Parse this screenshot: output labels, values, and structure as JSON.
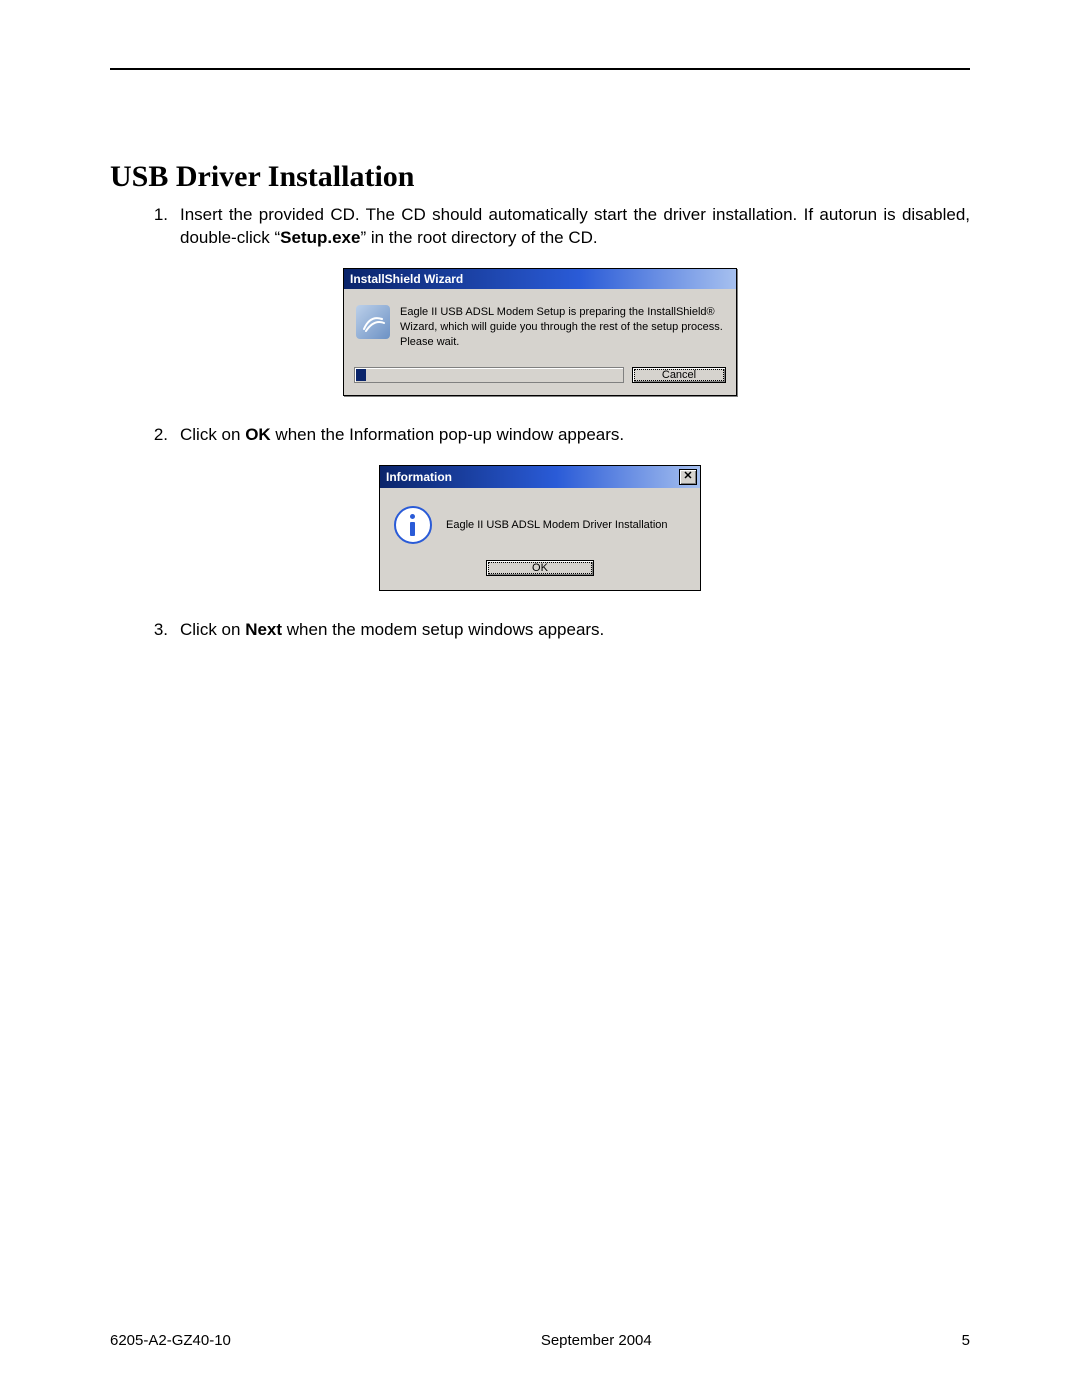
{
  "heading": "USB Driver Installation",
  "steps": {
    "s1": {
      "num": "1.",
      "pre": "Insert the provided CD. The CD should automatically start the driver installation. If autorun is disabled, double-click “",
      "setup": "Setup.exe",
      "post": "” in the root directory of the CD."
    },
    "s2": {
      "num": "2.",
      "pre": "Click on ",
      "ok": "OK",
      "post": " when the Information pop-up window appears."
    },
    "s3": {
      "num": "3.",
      "pre": "Click on ",
      "next": "Next",
      "post": " when the modem setup windows appears."
    }
  },
  "dlg1": {
    "title": "InstallShield Wizard",
    "text": "Eagle II USB ADSL Modem Setup is preparing the InstallShield® Wizard, which will guide you through the rest of the setup process. Please wait.",
    "cancel": "Cancel"
  },
  "dlg2": {
    "title": "Information",
    "text": "Eagle II USB ADSL Modem Driver Installation",
    "ok": "OK",
    "close": "✕"
  },
  "footer": {
    "left": "6205-A2-GZ40-10",
    "center": "September 2004",
    "right": "5"
  }
}
